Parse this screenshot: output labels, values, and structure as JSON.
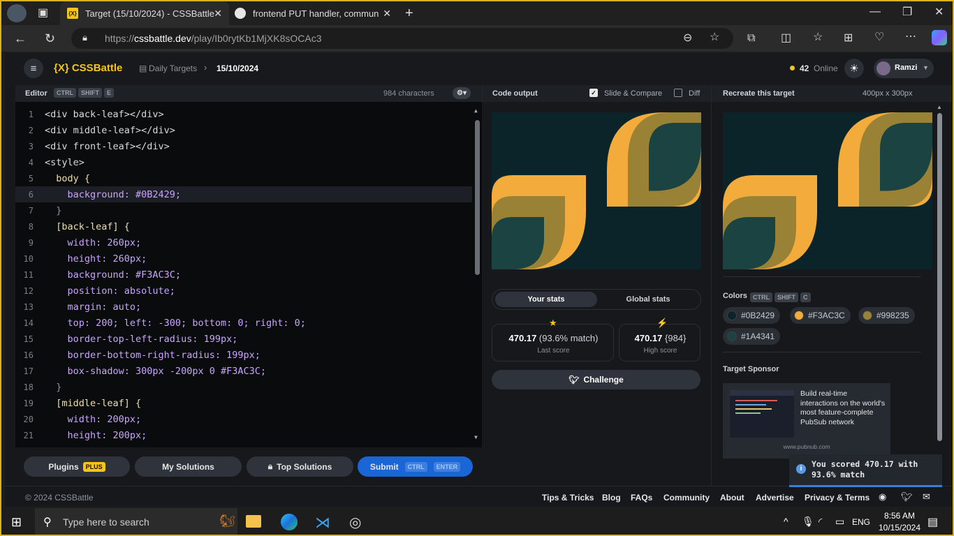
{
  "browser": {
    "tabs": [
      {
        "title": "Target (15/10/2024) - CSSBattle"
      },
      {
        "title": "frontend PUT handler, communic"
      }
    ],
    "url_prefix": "https://",
    "url_host": "cssbattle.dev",
    "url_path": "/play/Ib0rytKb1MjXK8sOCAc3"
  },
  "app": {
    "logo": "{X} CSSBattle",
    "breadcrumb_section": "Daily Targets",
    "breadcrumb_current": "15/10/2024",
    "online_count": "42",
    "online_label": "Online",
    "user_name": "Ramzi"
  },
  "editor": {
    "title": "Editor",
    "shortcut_keys": [
      "CTRL",
      "SHIFT",
      "E"
    ],
    "char_count": "984 characters",
    "lines": [
      {
        "n": "1",
        "text": "<div back-leaf></div>"
      },
      {
        "n": "2",
        "text": "<div middle-leaf></div>"
      },
      {
        "n": "3",
        "text": "<div front-leaf></div>"
      },
      {
        "n": "4",
        "text": "<style>"
      },
      {
        "n": "5",
        "text": "  body {"
      },
      {
        "n": "6",
        "text": "    background: #0B2429;"
      },
      {
        "n": "7",
        "text": "  }"
      },
      {
        "n": "8",
        "text": "  [back-leaf] {"
      },
      {
        "n": "9",
        "text": "    width: 260px;"
      },
      {
        "n": "10",
        "text": "    height: 260px;"
      },
      {
        "n": "11",
        "text": "    background: #F3AC3C;"
      },
      {
        "n": "12",
        "text": "    position: absolute;"
      },
      {
        "n": "13",
        "text": "    margin: auto;"
      },
      {
        "n": "14",
        "text": "    top: 200; left: -300; bottom: 0; right: 0;"
      },
      {
        "n": "15",
        "text": "    border-top-left-radius: 199px;"
      },
      {
        "n": "16",
        "text": "    border-bottom-right-radius: 199px;"
      },
      {
        "n": "17",
        "text": "    box-shadow: 300px -200px 0 #F3AC3C;"
      },
      {
        "n": "18",
        "text": "  }"
      },
      {
        "n": "19",
        "text": "  [middle-leaf] {"
      },
      {
        "n": "20",
        "text": "    width: 200px;"
      },
      {
        "n": "21",
        "text": "    height: 200px;"
      }
    ],
    "buttons": {
      "plugins": "Plugins",
      "plugins_badge": "PLUS",
      "my_solutions": "My Solutions",
      "top_solutions": "Top Solutions",
      "submit": "Submit",
      "submit_keys": [
        "CTRL",
        "ENTER"
      ]
    }
  },
  "output": {
    "title": "Code output",
    "slide_compare": "Slide & Compare",
    "diff": "Diff",
    "stats_tabs": [
      "Your stats",
      "Global stats"
    ],
    "last_score": "470.17",
    "last_match": "(93.6% match)",
    "last_label": "Last score",
    "high_score": "470.17",
    "high_chars": "{984}",
    "high_label": "High score",
    "challenge": "Challenge"
  },
  "target": {
    "title": "Recreate this target",
    "size": "400px x 300px",
    "colors_label": "Colors",
    "colors_keys": [
      "CTRL",
      "SHIFT",
      "C"
    ],
    "colors": [
      {
        "hex": "#0B2429",
        "color": "#0B2429"
      },
      {
        "hex": "#F3AC3C",
        "color": "#F3AC3C"
      },
      {
        "hex": "#998235",
        "color": "#998235"
      },
      {
        "hex": "#1A4341",
        "color": "#1A4341"
      }
    ],
    "sponsor_label": "Target Sponsor",
    "sponsor_text": "Build real-time interactions on the world's most feature-complete PubSub network",
    "sponsor_url": "www.pubnub.com"
  },
  "footer": {
    "copyright": "© 2024 CSSBattle",
    "links": [
      "Tips & Tricks",
      "Blog",
      "FAQs",
      "Community",
      "About",
      "Advertise",
      "Privacy & Terms"
    ]
  },
  "toast": {
    "message": "You scored 470.17 with 93.6% match"
  },
  "taskbar": {
    "search_placeholder": "Type here to search",
    "language": "ENG",
    "time": "8:56 AM",
    "date": "10/15/2024"
  }
}
